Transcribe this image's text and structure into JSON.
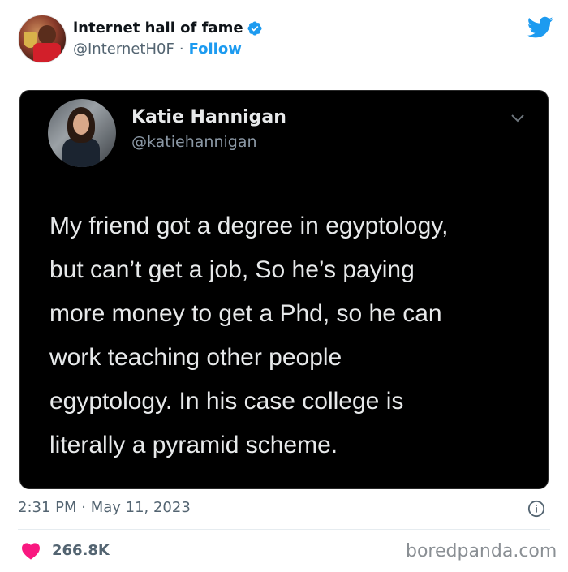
{
  "author": {
    "name": "internet hall of fame",
    "handle": "@InternetH0F",
    "separator": "·",
    "follow_label": "Follow"
  },
  "embedded": {
    "name": "Katie Hannigan",
    "handle": "@katiehannigan",
    "text": "My friend got a degree in egyptology,\nbut can’t get a job, So he’s paying\nmore money to get a Phd, so he can\nwork teaching other people\negyptology.  In his case college is\nliterally a pyramid scheme."
  },
  "meta": {
    "timestamp": "2:31 PM · May 11, 2023",
    "likes": "266.8K"
  },
  "watermark": "boredpanda.com",
  "colors": {
    "accent": "#1d9bf0",
    "heart": "#f91880",
    "card_bg": "#000000"
  },
  "icons": [
    "verified-icon",
    "twitter-bird-icon",
    "chevron-down-icon",
    "info-icon",
    "heart-icon"
  ]
}
